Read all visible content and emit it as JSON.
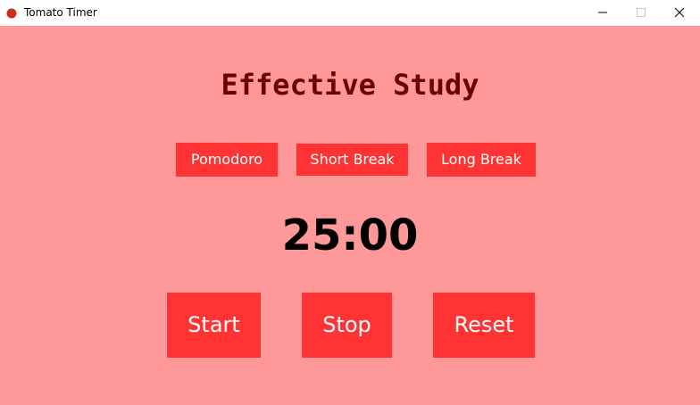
{
  "window": {
    "title": "Tomato Timer",
    "app_icon": "tomato-icon",
    "controls": {
      "minimize_icon": "minimize-icon",
      "maximize_icon": "maximize-icon",
      "close_icon": "close-icon"
    }
  },
  "main": {
    "heading": "Effective Study",
    "modes": [
      {
        "label": "Pomodoro"
      },
      {
        "label": "Short Break"
      },
      {
        "label": "Long Break"
      }
    ],
    "timer": "25:00",
    "actions": {
      "start_label": "Start",
      "stop_label": "Stop",
      "reset_label": "Reset"
    }
  },
  "colors": {
    "background": "#ff9999",
    "button": "#ff3333",
    "button_text": "#ffffff",
    "heading": "#6b0000",
    "timer": "#000000"
  }
}
